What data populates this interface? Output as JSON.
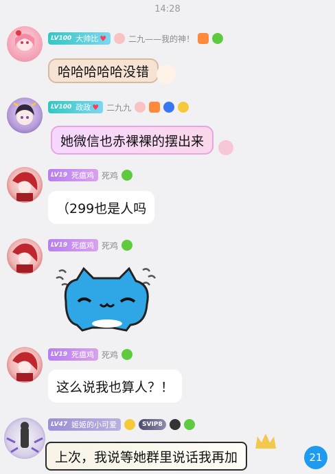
{
  "status": {
    "time": "14:28"
  },
  "messages": [
    {
      "level": "LV100",
      "level_name": "大帅比",
      "nickname": "二九——我的神！",
      "text": "哈哈哈哈哈没错"
    },
    {
      "level": "LV100",
      "level_name": "政政",
      "nickname": "二九九",
      "text": "她微信也赤裸裸的摆出来"
    },
    {
      "level": "LV19",
      "level_name": "死瘟鸡",
      "nickname": "死鸡",
      "text": "（299也是人吗"
    },
    {
      "level": "LV19",
      "level_name": "死瘟鸡",
      "nickname": "死鸡",
      "sticker": "blue-cat-sticker"
    },
    {
      "level": "LV19",
      "level_name": "死瘟鸡",
      "nickname": "死鸡",
      "text": "这么说我也算人？！"
    },
    {
      "level": "LV47",
      "level_name": "姬姬的小可爱",
      "badge_text": "SVIP8",
      "text": "上次，我说等她群里说话我再加"
    }
  ],
  "unread_count": "21",
  "colors": {
    "background": "#f1f1f3",
    "lv100": "#3cc9c0",
    "lv19": "#c089e8",
    "lv47": "#a99ad6",
    "unread": "#1e9bf0"
  }
}
